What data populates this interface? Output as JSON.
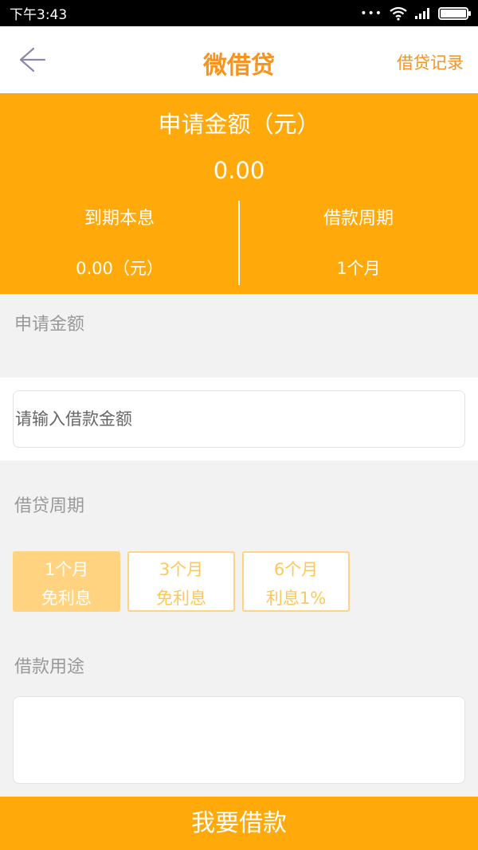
{
  "status_bar": {
    "time": "下午3:43",
    "dots": "•••",
    "signal": "▂▃▅▇"
  },
  "nav": {
    "title": "微借贷",
    "record_label": "借贷记录"
  },
  "summary": {
    "title": "申请金额（元）",
    "amount": "0.00",
    "due_label": "到期本息",
    "due_value": "0.00（元）",
    "period_label": "借款周期",
    "period_value": "1个月"
  },
  "form": {
    "amount_section_label": "申请金额",
    "amount_placeholder": "请输入借款金额",
    "amount_value": "",
    "period_section_label": "借贷周期",
    "periods": [
      {
        "label": "1个月",
        "note": "免利息",
        "selected": true
      },
      {
        "label": "3个月",
        "note": "免利息",
        "selected": false
      },
      {
        "label": "6个月",
        "note": "利息1%",
        "selected": false
      }
    ],
    "purpose_section_label": "借款用途",
    "purpose_value": ""
  },
  "submit_label": "我要借款",
  "colors": {
    "accent": "#ffa90a",
    "accent_text": "#f7931e",
    "period_border": "#ffd37f",
    "period_text": "#ffc659",
    "label_gray": "#999999"
  },
  "icons": {
    "back": "arrow-left-icon",
    "wifi": "wifi-icon",
    "signal": "signal-icon",
    "battery": "battery-icon"
  }
}
